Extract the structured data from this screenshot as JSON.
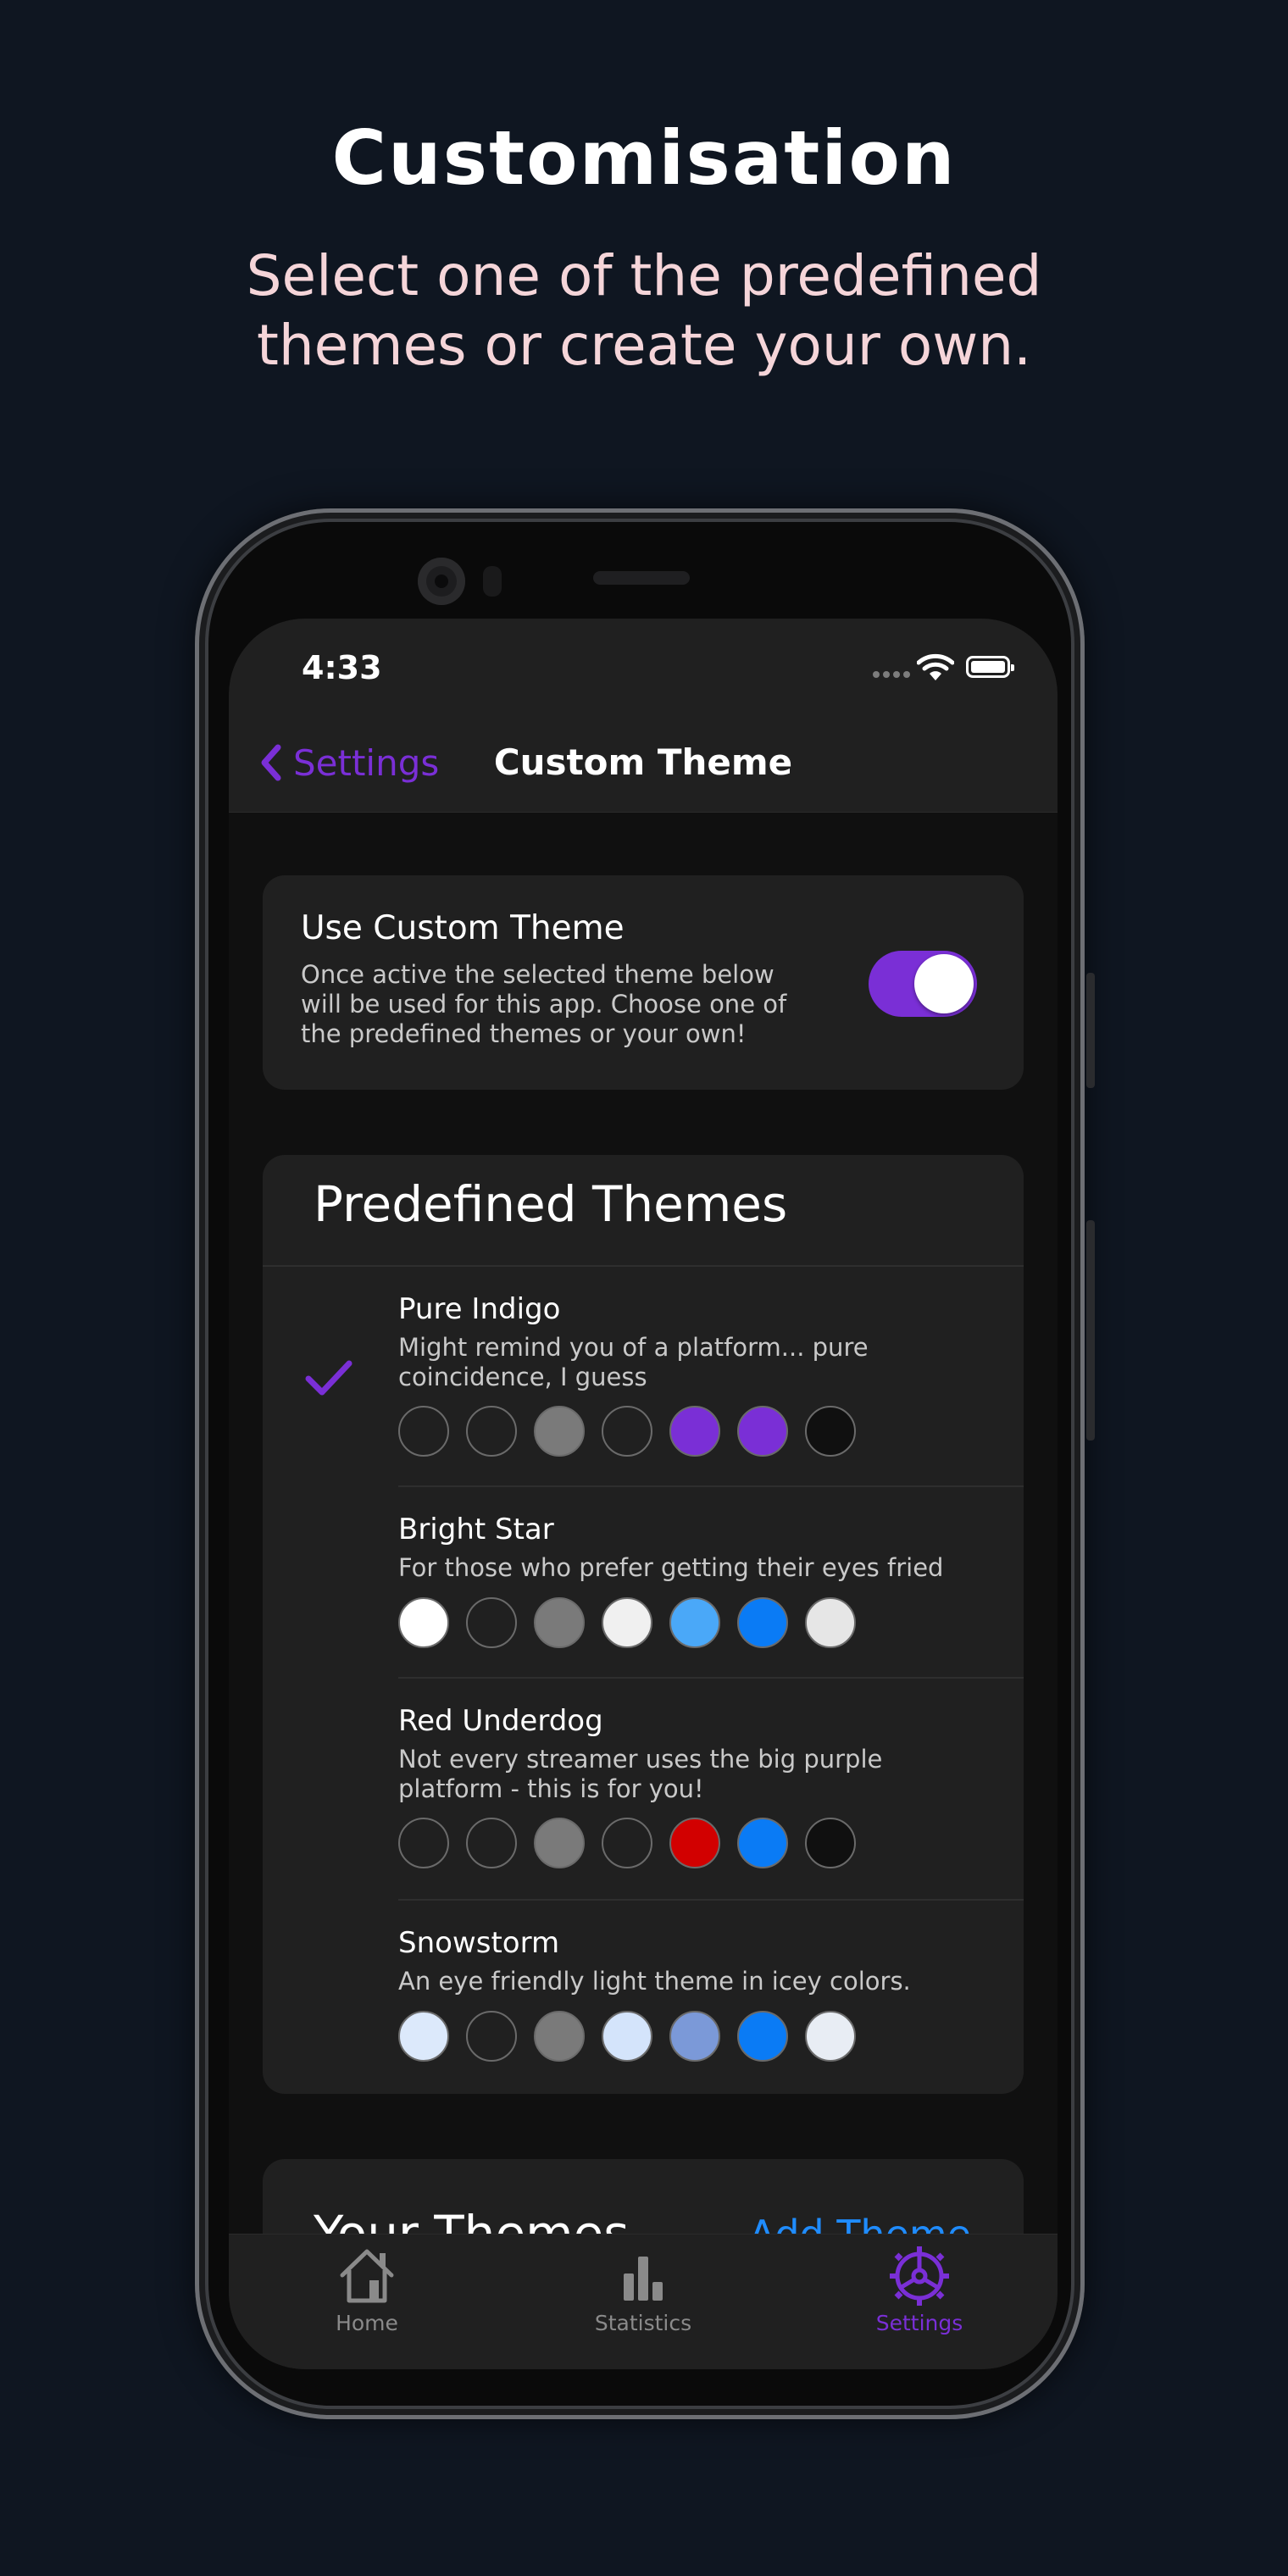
{
  "promo": {
    "headline": "Customisation",
    "subline_line1": "Select one of the predefined",
    "subline_line2": "themes or create your own."
  },
  "status_bar": {
    "time": "4:33"
  },
  "nav": {
    "back_label": "Settings",
    "title": "Custom Theme"
  },
  "custom_theme": {
    "title": "Use Custom Theme",
    "description": "Once active the selected theme below will be used for this app. Choose one of the predefined themes or your own!",
    "enabled": true
  },
  "predefined": {
    "title": "Predefined Themes",
    "themes": [
      {
        "name": "Pure Indigo",
        "description": "Might remind you of a platform... pure coincidence, I guess",
        "selected": true,
        "colors": [
          "#202020",
          "#202020",
          "#7a7a7a",
          "#202020",
          "#7a2fd6",
          "#7a2fd6",
          "#101010"
        ]
      },
      {
        "name": "Bright Star",
        "description": "For those who prefer getting their eyes fried",
        "selected": false,
        "colors": [
          "#ffffff",
          "#202020",
          "#7a7a7a",
          "#f0f0f0",
          "#4aa8f8",
          "#0a7bf5",
          "#e6e6e6"
        ]
      },
      {
        "name": "Red Underdog",
        "description": "Not every streamer uses the big purple platform - this is for you!",
        "selected": false,
        "colors": [
          "#202020",
          "#202020",
          "#7a7a7a",
          "#202020",
          "#d20000",
          "#0a7bf5",
          "#101010"
        ]
      },
      {
        "name": "Snowstorm",
        "description": "An eye friendly light theme in icey colors.",
        "selected": false,
        "colors": [
          "#dce9fb",
          "#202020",
          "#7a7a7a",
          "#d4e4fb",
          "#7b99d8",
          "#0a7bf5",
          "#e8edf4"
        ]
      }
    ]
  },
  "your_themes": {
    "title": "Your Themes",
    "add_label": "Add Theme"
  },
  "tabs": [
    {
      "label": "Home",
      "icon": "house-icon",
      "active": false
    },
    {
      "label": "Statistics",
      "icon": "bar-chart-icon",
      "active": false
    },
    {
      "label": "Settings",
      "icon": "gear-icon",
      "active": true
    }
  ],
  "colors": {
    "accent": "#7a2fd6",
    "link_blue": "#1f8cff",
    "background": "#0f1621",
    "card": "#202020",
    "subline": "#f5d5d9"
  }
}
